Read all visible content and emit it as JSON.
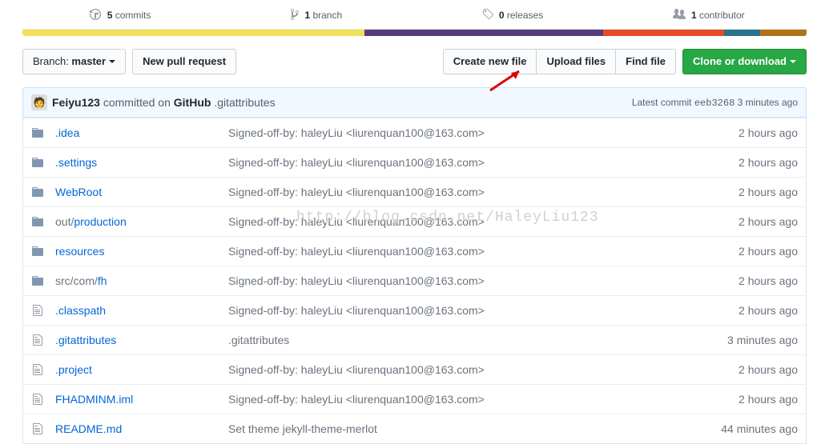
{
  "stats": {
    "commits_num": "5",
    "commits_label": " commits",
    "branch_num": "1",
    "branch_label": " branch",
    "releases_num": "0",
    "releases_label": " releases",
    "contributor_num": "1",
    "contributor_label": " contributor"
  },
  "toolbar": {
    "branch_pre": "Branch: ",
    "branch_name": "master",
    "new_pr": "New pull request",
    "create_file": "Create new file",
    "upload": "Upload files",
    "find": "Find file",
    "clone": "Clone or download"
  },
  "commit": {
    "author": "Feiyu123",
    "mid": " committed on ",
    "where": "GitHub",
    "file": " .gitattributes",
    "right_pre": "Latest commit ",
    "hash": "eeb3268",
    "ago": " 3 minutes ago"
  },
  "files": [
    {
      "t": "d",
      "name_pre": "",
      "name": ".idea",
      "msg": "Signed-off-by: haleyLiu <liurenquan100@163.com>",
      "age": "2 hours ago"
    },
    {
      "t": "d",
      "name_pre": "",
      "name": ".settings",
      "msg": "Signed-off-by: haleyLiu <liurenquan100@163.com>",
      "age": "2 hours ago"
    },
    {
      "t": "d",
      "name_pre": "",
      "name": "WebRoot",
      "msg": "Signed-off-by: haleyLiu <liurenquan100@163.com>",
      "age": "2 hours ago"
    },
    {
      "t": "d",
      "name_pre": "out/",
      "name": "production",
      "msg": "Signed-off-by: haleyLiu <liurenquan100@163.com>",
      "age": "2 hours ago"
    },
    {
      "t": "d",
      "name_pre": "",
      "name": "resources",
      "msg": "Signed-off-by: haleyLiu <liurenquan100@163.com>",
      "age": "2 hours ago"
    },
    {
      "t": "d",
      "name_pre": "src/com/",
      "name": "fh",
      "msg": "Signed-off-by: haleyLiu <liurenquan100@163.com>",
      "age": "2 hours ago"
    },
    {
      "t": "f",
      "name_pre": "",
      "name": ".classpath",
      "msg": "Signed-off-by: haleyLiu <liurenquan100@163.com>",
      "age": "2 hours ago"
    },
    {
      "t": "f",
      "name_pre": "",
      "name": ".gitattributes",
      "msg": ".gitattributes",
      "age": "3 minutes ago"
    },
    {
      "t": "f",
      "name_pre": "",
      "name": ".project",
      "msg": "Signed-off-by: haleyLiu <liurenquan100@163.com>",
      "age": "2 hours ago"
    },
    {
      "t": "f",
      "name_pre": "",
      "name": "FHADMINM.iml",
      "msg": "Signed-off-by: haleyLiu <liurenquan100@163.com>",
      "age": "2 hours ago"
    },
    {
      "t": "f",
      "name_pre": "",
      "name": "README.md",
      "msg": "Set theme jekyll-theme-merlot",
      "age": "44 minutes ago"
    }
  ],
  "watermark": "http://blog.csdn.net/HaleyLiu123"
}
